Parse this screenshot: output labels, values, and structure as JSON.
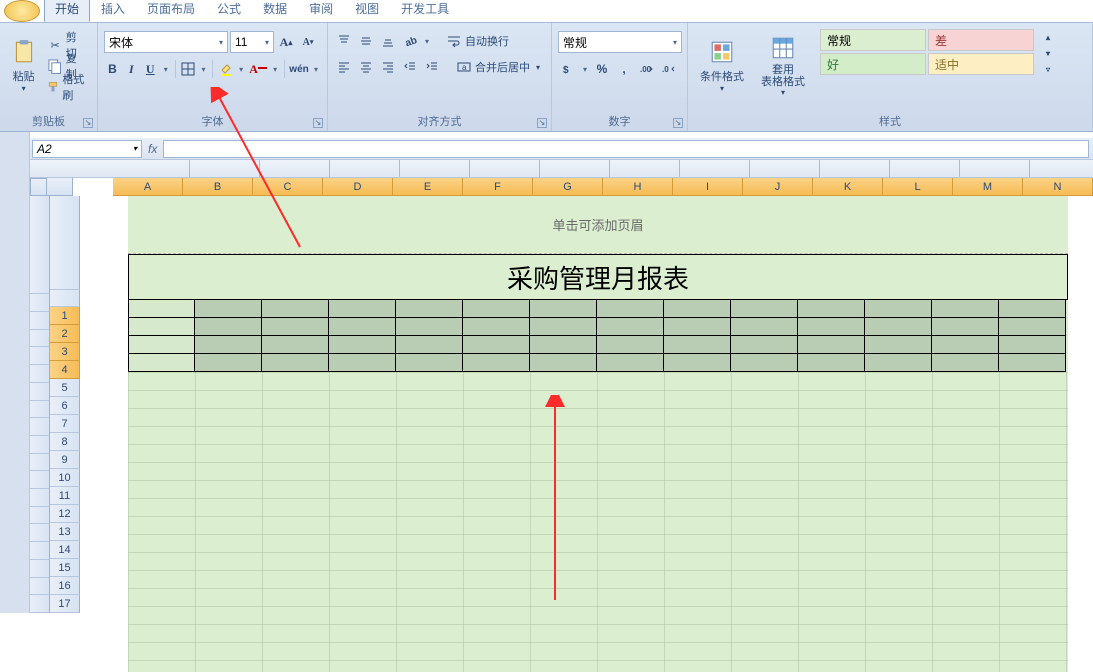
{
  "tabs": {
    "t0": "开始",
    "t1": "插入",
    "t2": "页面布局",
    "t3": "公式",
    "t4": "数据",
    "t5": "审阅",
    "t6": "视图",
    "t7": "开发工具"
  },
  "clipboard": {
    "paste": "粘贴",
    "cut": "剪切",
    "copy": "复制",
    "painter": "格式刷",
    "label": "剪贴板"
  },
  "font": {
    "name": "宋体",
    "size": "11",
    "label": "字体"
  },
  "align": {
    "wrap": "自动换行",
    "merge": "合并后居中",
    "label": "对齐方式"
  },
  "number": {
    "fmt": "常规",
    "label": "数字"
  },
  "styles": {
    "cond": "条件格式",
    "table": "套用\n表格格式",
    "s0": "常规",
    "s1": "差",
    "s2": "好",
    "s3": "适中",
    "label": "样式"
  },
  "namebox": "A2",
  "columns": [
    "A",
    "B",
    "C",
    "D",
    "E",
    "F",
    "G",
    "H",
    "I",
    "J",
    "K",
    "L",
    "M",
    "N"
  ],
  "rows_left": [
    "",
    "",
    "",
    "",
    "",
    "",
    "",
    "",
    "",
    "",
    "",
    "",
    "",
    "",
    "",
    "",
    "",
    ""
  ],
  "rows_right": [
    "",
    "1",
    "2",
    "3",
    "4",
    "5",
    "6",
    "7",
    "8",
    "9",
    "10",
    "11",
    "12",
    "13",
    "14",
    "15",
    "16",
    "17"
  ],
  "page": {
    "header_hint": "单击可添加页眉",
    "title": "采购管理月报表"
  }
}
